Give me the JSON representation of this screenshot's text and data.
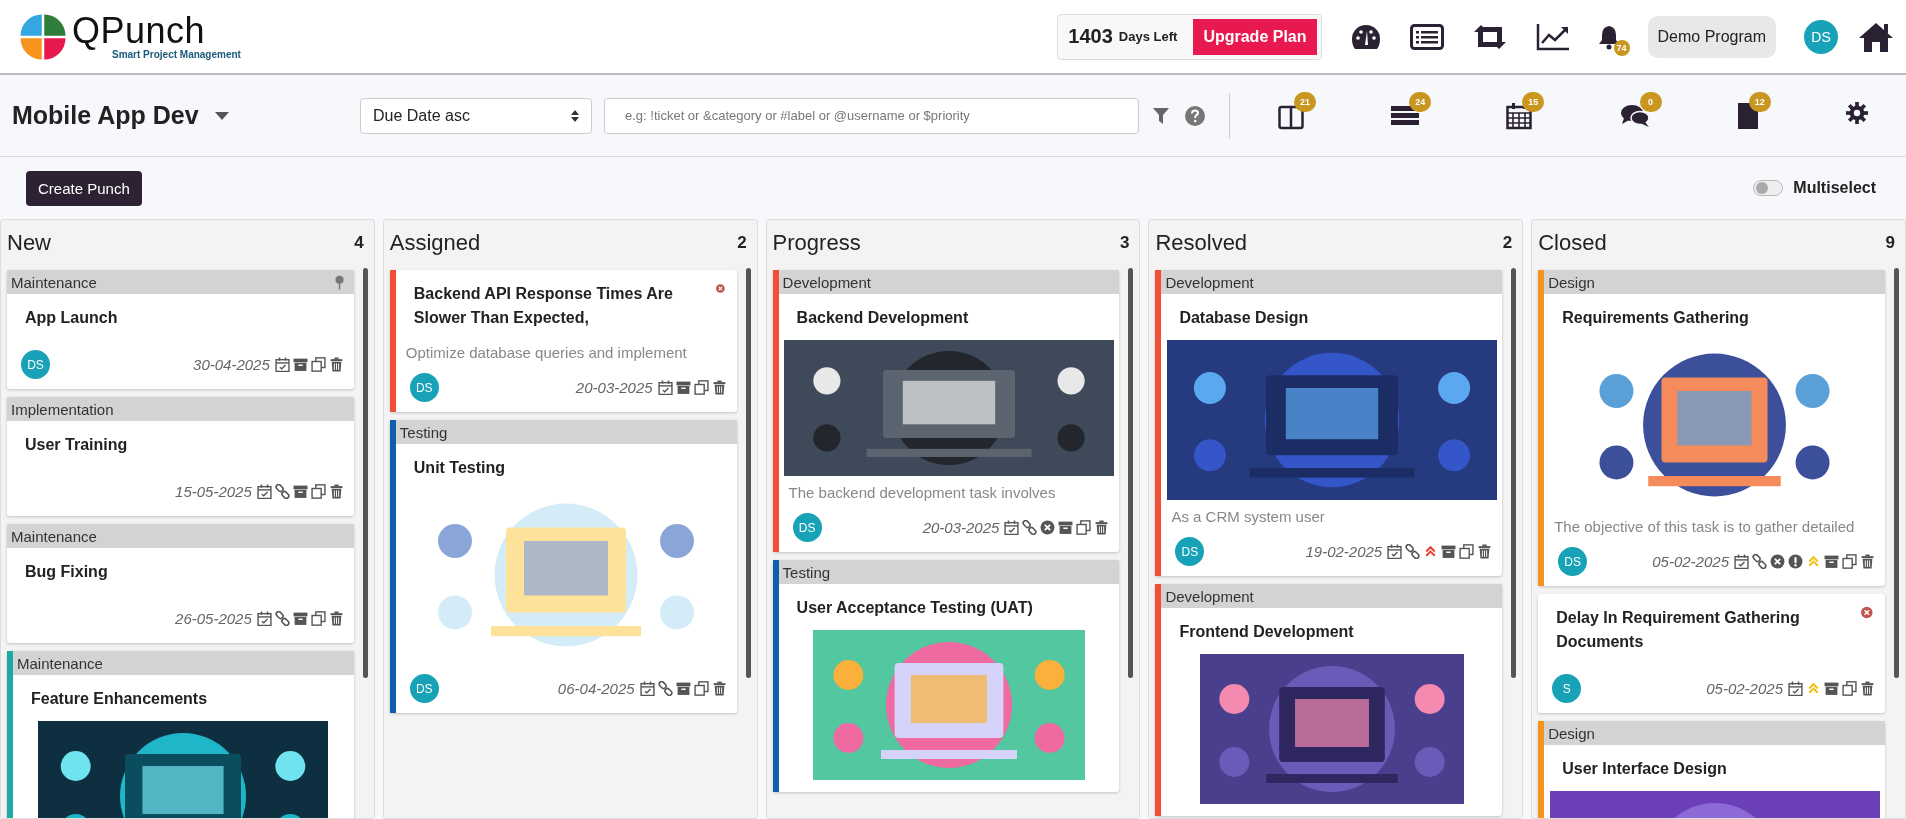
{
  "header": {
    "logo": {
      "name": "QPunch",
      "tagline": "Smart Project Management"
    },
    "license": {
      "days": "1403",
      "days_label": "Days Left",
      "upgrade": "Upgrade Plan"
    },
    "nav_icons": [
      {
        "kind": "gauge"
      },
      {
        "kind": "list"
      },
      {
        "kind": "repeat"
      },
      {
        "kind": "chart"
      },
      {
        "kind": "bell",
        "badge": "74"
      }
    ],
    "program": "Demo Program",
    "user": "DS"
  },
  "toolbar": {
    "project": "Mobile App Dev",
    "sort": "Due Date asc",
    "search": {
      "placeholder": "e.g: !ticket or &category or #label or @username or $priority"
    },
    "views": [
      {
        "kind": "board",
        "badge": "21"
      },
      {
        "kind": "stack",
        "badge": "24"
      },
      {
        "kind": "calendar",
        "badge": "15"
      },
      {
        "kind": "chat",
        "badge": "0"
      },
      {
        "kind": "note",
        "badge": "12"
      },
      {
        "kind": "settings"
      }
    ]
  },
  "create_button": "Create Punch",
  "multiselect": {
    "label": "Multiselect",
    "on": false
  },
  "columns": [
    {
      "title": "New",
      "count": "4",
      "cards": [
        {
          "category": "Maintenance",
          "pinned": true,
          "title": "App Launch",
          "avatar": "DS",
          "date": "30-04-2025",
          "icons": [
            {
              "kind": "calendar"
            },
            {
              "kind": "archive"
            },
            {
              "kind": "copy"
            },
            {
              "kind": "trash"
            }
          ]
        },
        {
          "category": "Implementation",
          "title": "User Training",
          "date": "15-05-2025",
          "icons": [
            {
              "kind": "calendar"
            },
            {
              "kind": "link"
            },
            {
              "kind": "archive"
            },
            {
              "kind": "copy"
            },
            {
              "kind": "trash"
            }
          ]
        },
        {
          "category": "Maintenance",
          "title": "Bug Fixing",
          "date": "26-05-2025",
          "icons": [
            {
              "kind": "calendar"
            },
            {
              "kind": "link"
            },
            {
              "kind": "archive"
            },
            {
              "kind": "copy"
            },
            {
              "kind": "trash"
            }
          ]
        },
        {
          "category": "Maintenance",
          "color": "#1fa9a3",
          "title": "Feature Enhancements",
          "media": {
            "kind": "picture"
          }
        }
      ]
    },
    {
      "title": "Assigned",
      "count": "2",
      "cards": [
        {
          "color": "#f04e37",
          "flagged": true,
          "title": "Backend API Response Times Are Slower Than Expected,",
          "description": "Optimize database queries and implement",
          "avatar": "DS",
          "date": "20-03-2025",
          "icons": [
            {
              "kind": "calendar"
            },
            {
              "kind": "archive"
            },
            {
              "kind": "copy"
            },
            {
              "kind": "trash"
            }
          ]
        },
        {
          "category": "Testing",
          "color": "#0b5fad",
          "title": "Unit Testing",
          "media": {
            "kind": "picture"
          },
          "avatar": "DS",
          "date": "06-04-2025",
          "icons": [
            {
              "kind": "calendar"
            },
            {
              "kind": "link"
            },
            {
              "kind": "archive"
            },
            {
              "kind": "copy"
            },
            {
              "kind": "trash"
            }
          ]
        }
      ]
    },
    {
      "title": "Progress",
      "count": "3",
      "cards": [
        {
          "category": "Development",
          "color": "#f04e37",
          "title": "Backend Development",
          "media": {
            "kind": "picture"
          },
          "description": "The backend development task involves",
          "avatar": "DS",
          "date": "20-03-2025",
          "icons": [
            {
              "kind": "calendar"
            },
            {
              "kind": "link"
            },
            {
              "kind": "cancel"
            },
            {
              "kind": "archive"
            },
            {
              "kind": "copy"
            },
            {
              "kind": "trash"
            }
          ]
        },
        {
          "category": "Testing",
          "color": "#0b5fad",
          "title": "User Acceptance Testing (UAT)",
          "media": {
            "kind": "picture"
          }
        }
      ]
    },
    {
      "title": "Resolved",
      "count": "2",
      "cards": [
        {
          "category": "Development",
          "color": "#f04e37",
          "title": "Database Design",
          "media": {
            "kind": "picture"
          },
          "description": "As a CRM system user",
          "avatar": "DS",
          "date": "19-02-2025",
          "icons": [
            {
              "kind": "calendar"
            },
            {
              "kind": "link"
            },
            {
              "kind": "priority-high"
            },
            {
              "kind": "archive"
            },
            {
              "kind": "copy"
            },
            {
              "kind": "trash"
            }
          ]
        },
        {
          "category": "Development",
          "color": "#f04e37",
          "title": "Frontend Development",
          "media": {
            "kind": "picture"
          }
        }
      ]
    },
    {
      "title": "Closed",
      "count": "9",
      "cards": [
        {
          "category": "Design",
          "color": "#f7941d",
          "title": "Requirements Gathering",
          "media": {
            "kind": "picture"
          },
          "description": "The objective of this task is to gather detailed",
          "avatar": "DS",
          "date": "05-02-2025",
          "icons": [
            {
              "kind": "calendar"
            },
            {
              "kind": "link"
            },
            {
              "kind": "cancel"
            },
            {
              "kind": "alert"
            },
            {
              "kind": "priority-medium"
            },
            {
              "kind": "archive"
            },
            {
              "kind": "copy"
            },
            {
              "kind": "trash"
            }
          ]
        },
        {
          "flagged": true,
          "title": "Delay In Requirement Gathering Documents",
          "avatar": "S",
          "date": "05-02-2025",
          "icons": [
            {
              "kind": "calendar"
            },
            {
              "kind": "priority-medium"
            },
            {
              "kind": "archive"
            },
            {
              "kind": "copy"
            },
            {
              "kind": "trash"
            }
          ]
        },
        {
          "category": "Design",
          "color": "#f7941d",
          "title": "User Interface Design",
          "media": {
            "kind": "picture"
          }
        }
      ]
    }
  ]
}
